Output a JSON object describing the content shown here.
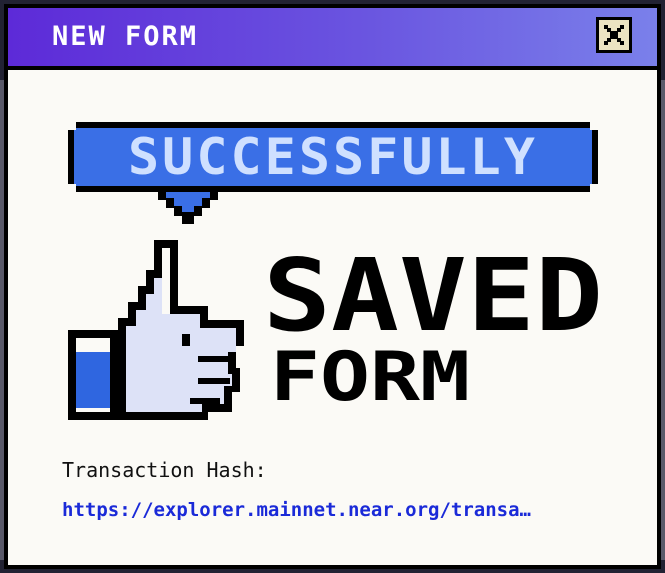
{
  "window": {
    "title": "NEW FORM",
    "close_icon": "close-x-icon"
  },
  "banner": {
    "headline": "SUCCESSFULLY",
    "status_word": "SAVED",
    "object_word": "FORM",
    "icon": "thumbs-up-icon",
    "colors": {
      "bubble_fill": "#3a6fe6",
      "bubble_text": "#cfe0ff",
      "thumb_fill": "#dde2f7",
      "cuff_fill": "#2f66e0",
      "outline": "#000000"
    }
  },
  "transaction": {
    "label": "Transaction Hash:",
    "link_text": "https://explorer.mainnet.near.org/transa…",
    "link_color": "#1a2ad8"
  },
  "colors": {
    "titlebar_start": "#5d2ad8",
    "titlebar_end": "#7a80ea",
    "panel_bg": "#fbfaf6",
    "close_bg": "#ece3c2"
  }
}
